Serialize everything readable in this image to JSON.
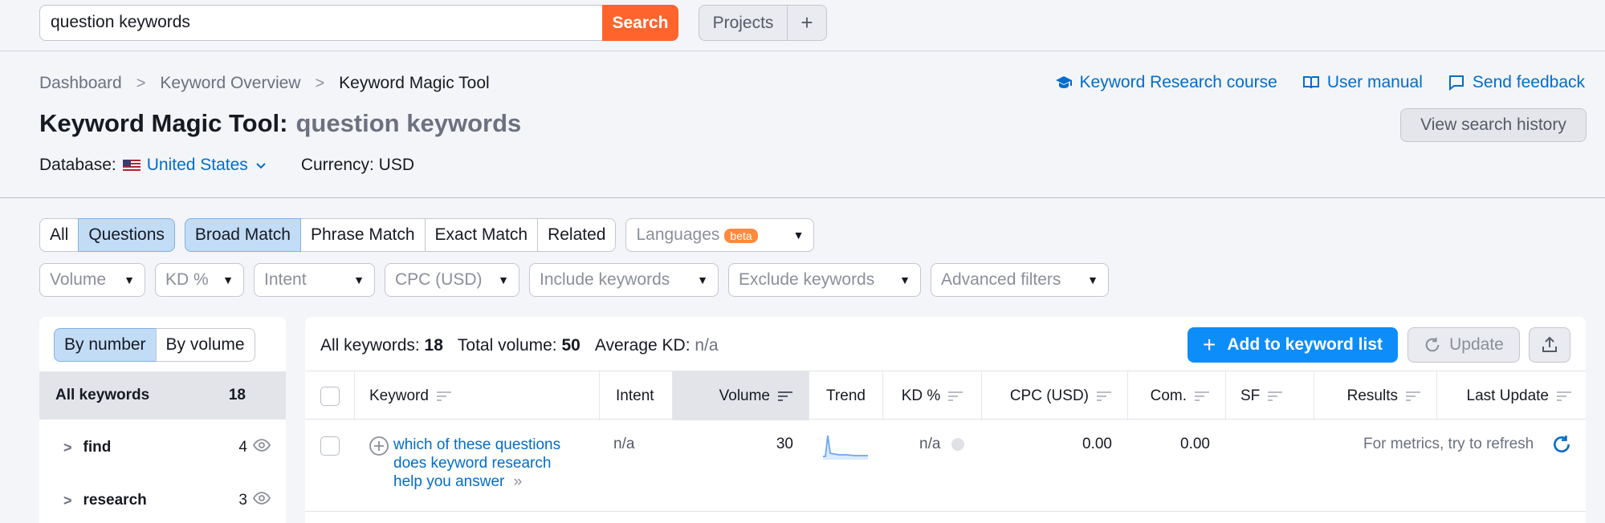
{
  "search": {
    "value": "question keywords",
    "button": "Search"
  },
  "projects": {
    "label": "Projects",
    "plus": "+"
  },
  "breadcrumb": [
    "Dashboard",
    "Keyword Overview",
    "Keyword Magic Tool"
  ],
  "top_links": {
    "course": "Keyword Research course",
    "manual": "User manual",
    "feedback": "Send feedback"
  },
  "title": {
    "tool": "Keyword Magic Tool:",
    "query": "question keywords"
  },
  "history_button": "View search history",
  "database": {
    "label": "Database:",
    "country": "United States",
    "currency": "Currency: USD"
  },
  "tabs_scope": [
    {
      "label": "All"
    },
    {
      "label": "Questions"
    }
  ],
  "tabs_match": [
    {
      "label": "Broad Match"
    },
    {
      "label": "Phrase Match"
    },
    {
      "label": "Exact Match"
    },
    {
      "label": "Related"
    }
  ],
  "languages": {
    "label": "Languages",
    "badge": "beta"
  },
  "filters": [
    "Volume",
    "KD %",
    "Intent",
    "CPC (USD)",
    "Include keywords",
    "Exclude keywords",
    "Advanced filters"
  ],
  "left_panel": {
    "toggle": [
      "By number",
      "By volume"
    ],
    "all_label": "All keywords",
    "all_count": "18",
    "groups": [
      {
        "name": "find",
        "count": "4"
      },
      {
        "name": "research",
        "count": "3"
      }
    ]
  },
  "summary": {
    "all_label": "All keywords:",
    "all_value": "18",
    "vol_label": "Total volume:",
    "vol_value": "50",
    "kd_label": "Average KD:",
    "kd_value": "n/a"
  },
  "actions": {
    "add": "Add to keyword list",
    "update": "Update"
  },
  "columns": [
    "Keyword",
    "Intent",
    "Volume",
    "Trend",
    "KD %",
    "CPC (USD)",
    "Com.",
    "SF",
    "Results",
    "Last Update"
  ],
  "rows": [
    {
      "keyword_l1": "which of these questions",
      "keyword_l2": "does keyword research",
      "keyword_l3": "help you answer",
      "intent": "n/a",
      "volume": "30",
      "kd": "n/a",
      "cpc": "0.00",
      "com": "0.00",
      "last_update": "For metrics, try to refresh"
    }
  ],
  "colors": {
    "accent": "#006dca",
    "search": "#ff642d",
    "primary": "#0d8dfa",
    "chip_active": "#c2dcf6"
  }
}
